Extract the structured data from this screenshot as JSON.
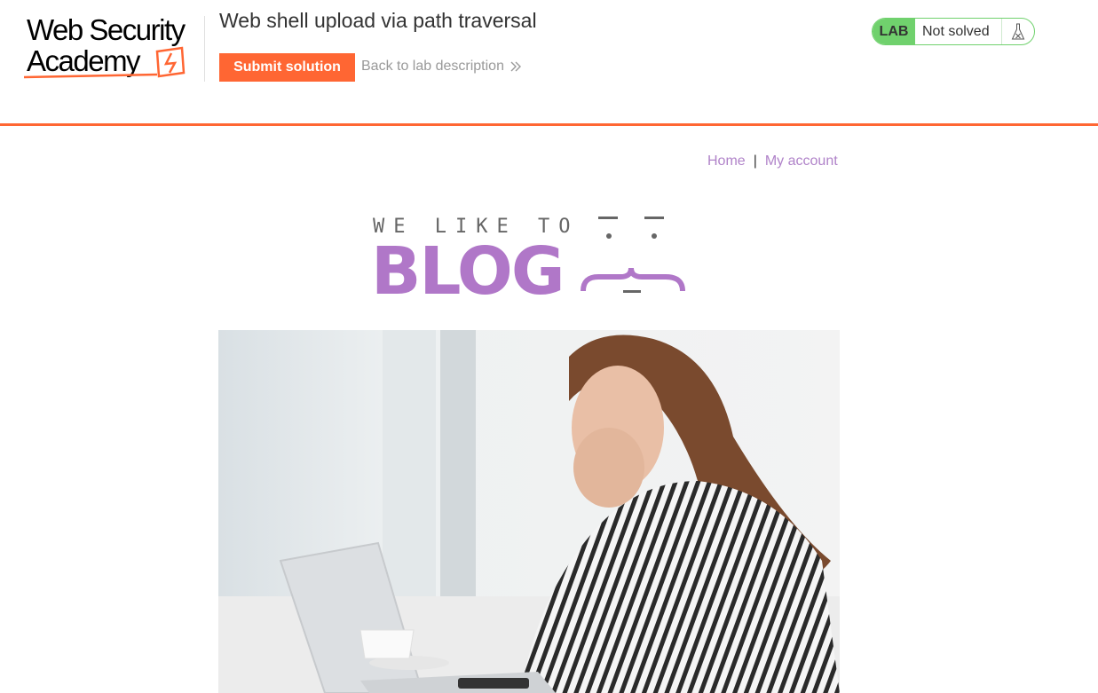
{
  "header": {
    "logo": {
      "line1": "Web Security",
      "line2": "Academy"
    },
    "lab_title": "Web shell upload via path traversal",
    "submit_label": "Submit solution",
    "back_label": "Back to lab description",
    "status": {
      "badge": "LAB",
      "text": "Not solved"
    }
  },
  "nav": {
    "home": "Home",
    "separator": "|",
    "account": "My account"
  },
  "banner": {
    "tagline": "WE LIKE TO",
    "word": "BLOG"
  },
  "colors": {
    "accent": "#ff6633",
    "lab_green": "#70d16d",
    "link_purple": "#b083c9",
    "blog_purple": "#b077c8"
  },
  "icons": [
    "chevron-double-right-icon",
    "flask-icon"
  ]
}
